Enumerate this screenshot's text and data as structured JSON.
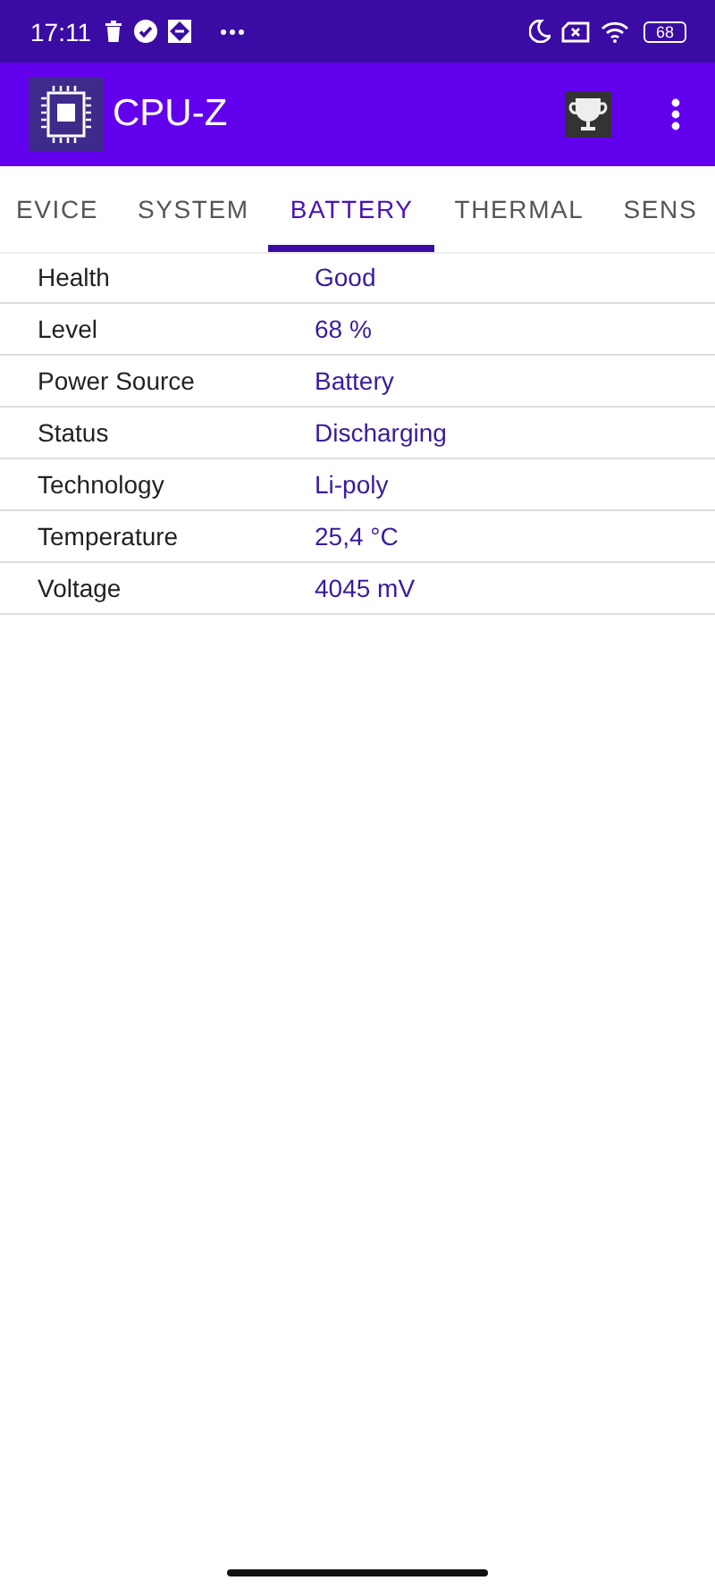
{
  "status_bar": {
    "time": "17:11",
    "battery": "68"
  },
  "app_bar": {
    "title": "CPU-Z"
  },
  "tabs": [
    {
      "label": "EVICE",
      "selected": false
    },
    {
      "label": "SYSTEM",
      "selected": false
    },
    {
      "label": "BATTERY",
      "selected": true
    },
    {
      "label": "THERMAL",
      "selected": false
    },
    {
      "label": "SENS",
      "selected": false
    }
  ],
  "rows": [
    {
      "label": "Health",
      "value": "Good"
    },
    {
      "label": "Level",
      "value": "68 %"
    },
    {
      "label": "Power Source",
      "value": "Battery"
    },
    {
      "label": "Status",
      "value": "Discharging"
    },
    {
      "label": "Technology",
      "value": "Li-poly"
    },
    {
      "label": "Temperature",
      "value": "25,4 °C"
    },
    {
      "label": "Voltage",
      "value": "4045 mV"
    }
  ]
}
